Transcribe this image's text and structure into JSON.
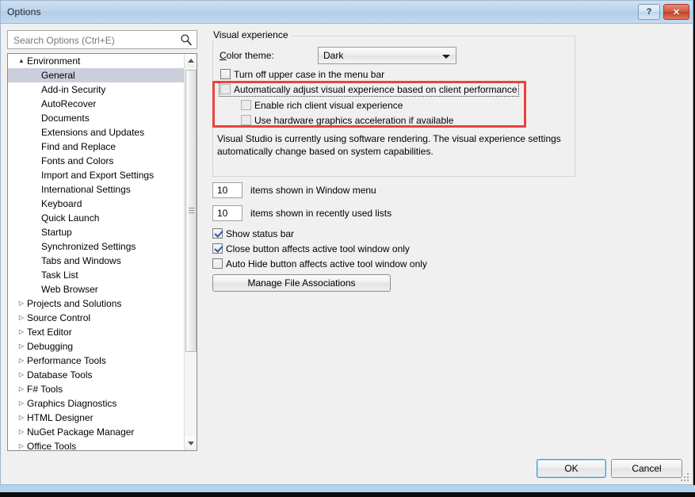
{
  "window": {
    "title": "Options",
    "help_button": "?",
    "close_button": "✕"
  },
  "search": {
    "placeholder": "Search Options (Ctrl+E)",
    "value": "",
    "icon": "search-icon"
  },
  "tree": {
    "items": [
      {
        "label": "Environment",
        "level": "root",
        "twisty": "▲",
        "selected": false
      },
      {
        "label": "General",
        "level": "child",
        "twisty": "",
        "selected": true
      },
      {
        "label": "Add-in Security",
        "level": "child",
        "twisty": "",
        "selected": false
      },
      {
        "label": "AutoRecover",
        "level": "child",
        "twisty": "",
        "selected": false
      },
      {
        "label": "Documents",
        "level": "child",
        "twisty": "",
        "selected": false
      },
      {
        "label": "Extensions and Updates",
        "level": "child",
        "twisty": "",
        "selected": false
      },
      {
        "label": "Find and Replace",
        "level": "child",
        "twisty": "",
        "selected": false
      },
      {
        "label": "Fonts and Colors",
        "level": "child",
        "twisty": "",
        "selected": false
      },
      {
        "label": "Import and Export Settings",
        "level": "child",
        "twisty": "",
        "selected": false
      },
      {
        "label": "International Settings",
        "level": "child",
        "twisty": "",
        "selected": false
      },
      {
        "label": "Keyboard",
        "level": "child",
        "twisty": "",
        "selected": false
      },
      {
        "label": "Quick Launch",
        "level": "child",
        "twisty": "",
        "selected": false
      },
      {
        "label": "Startup",
        "level": "child",
        "twisty": "",
        "selected": false
      },
      {
        "label": "Synchronized Settings",
        "level": "child",
        "twisty": "",
        "selected": false
      },
      {
        "label": "Tabs and Windows",
        "level": "child",
        "twisty": "",
        "selected": false
      },
      {
        "label": "Task List",
        "level": "child",
        "twisty": "",
        "selected": false
      },
      {
        "label": "Web Browser",
        "level": "child",
        "twisty": "",
        "selected": false
      },
      {
        "label": "Projects and Solutions",
        "level": "root",
        "twisty": "▷",
        "selected": false
      },
      {
        "label": "Source Control",
        "level": "root",
        "twisty": "▷",
        "selected": false
      },
      {
        "label": "Text Editor",
        "level": "root",
        "twisty": "▷",
        "selected": false
      },
      {
        "label": "Debugging",
        "level": "root",
        "twisty": "▷",
        "selected": false
      },
      {
        "label": "Performance Tools",
        "level": "root",
        "twisty": "▷",
        "selected": false
      },
      {
        "label": "Database Tools",
        "level": "root",
        "twisty": "▷",
        "selected": false
      },
      {
        "label": "F# Tools",
        "level": "root",
        "twisty": "▷",
        "selected": false
      },
      {
        "label": "Graphics Diagnostics",
        "level": "root",
        "twisty": "▷",
        "selected": false
      },
      {
        "label": "HTML Designer",
        "level": "root",
        "twisty": "▷",
        "selected": false
      },
      {
        "label": "NuGet Package Manager",
        "level": "root",
        "twisty": "▷",
        "selected": false
      },
      {
        "label": "Office Tools",
        "level": "root",
        "twisty": "▷",
        "selected": false
      }
    ]
  },
  "main": {
    "group_title": "Visual experience",
    "color_theme_label": "Color theme:",
    "color_theme_value": "Dark",
    "checkbox_uppercase": "Turn off upper case in the menu bar",
    "checkbox_auto_adjust": "Automatically adjust visual experience based on client performance",
    "checkbox_rich_client": "Enable rich client visual experience",
    "checkbox_hardware_accel": "Use hardware graphics acceleration if available",
    "description": "Visual Studio is currently using software rendering.  The visual experience settings automatically change based on system capabilities.",
    "window_menu_value": "10",
    "window_menu_label": "items shown in Window menu",
    "recent_lists_value": "10",
    "recent_lists_label": "items shown in recently used lists",
    "checkbox_status_bar": "Show status bar",
    "checkbox_close_button": "Close button affects active tool window only",
    "checkbox_autohide_button": "Auto Hide button affects active tool window only",
    "manage_file_associations": "Manage File Associations"
  },
  "footer": {
    "ok": "OK",
    "cancel": "Cancel"
  },
  "colors": {
    "annotation": "#e8453c",
    "selection": "#cbcfdc",
    "titlebar": "#bcd5ec",
    "check": "#2b5caa"
  }
}
